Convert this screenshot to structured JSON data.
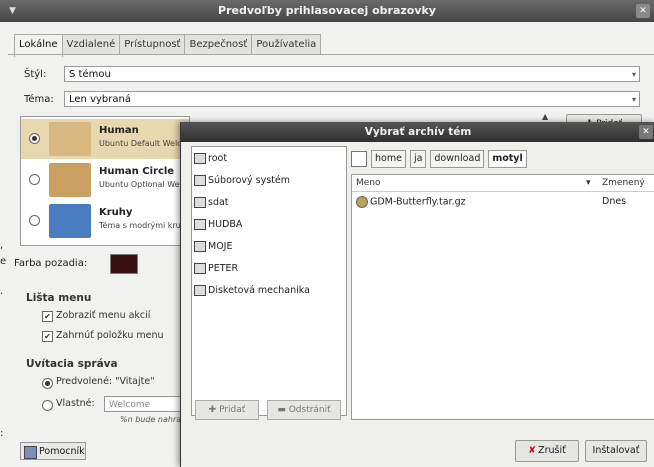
{
  "main_window": {
    "title": "Predvoľby prihlasovacej obrazovky",
    "tabs": [
      "Lokálne",
      "Vzdialené",
      "Prístupnosť",
      "Bezpečnosť",
      "Používatelia"
    ],
    "active_tab": 0,
    "style_label": "Štýl:",
    "style_value": "S témou",
    "theme_label": "Téma:",
    "theme_value": "Len vybraná",
    "themes": [
      {
        "name": "Human",
        "description": "Ubuntu Default Welcome",
        "selected": true
      },
      {
        "name": "Human Circle",
        "description": "Ubuntu Optional Welcome",
        "selected": false
      },
      {
        "name": "Kruhy",
        "description": "Téma s modrými kruhmi",
        "selected": false
      }
    ],
    "add_button": "Pridať",
    "background_color_label": "Farba pozadia:",
    "menu_bar_heading": "Lišta menu",
    "show_actions_menu": "Zobraziť menu akcií",
    "include_config_item": "Zahrnúť položku menu",
    "welcome_heading": "Uvítacia správa",
    "welcome_default": "Predvolené: \"Vitajte\"",
    "welcome_custom": "Vlastné:",
    "welcome_input_value": "Welcome",
    "welcome_note": "%n bude nahradené",
    "help_button": "Pomocník"
  },
  "dialog": {
    "title": "Vybrať archív tém",
    "places": [
      "root",
      "Súborový systém",
      "sdat",
      "HUDBA",
      "MOJE",
      "PETER",
      "Disketová mechanika"
    ],
    "add_place_button": "Pridať",
    "remove_place_button": "Odstrániť",
    "path": [
      "home",
      "ja",
      "download",
      "motyl"
    ],
    "active_path_index": 3,
    "columns": {
      "name": "Meno",
      "modified": "Zmenený"
    },
    "files": [
      {
        "name": "GDM-Butterfly.tar.gz",
        "modified": "Dnes"
      }
    ],
    "cancel_button": "Zrušiť",
    "install_button": "Inštalovať"
  },
  "colors": {
    "background_color_swatch": "#3a1010",
    "selection": "#e8d8b0"
  }
}
